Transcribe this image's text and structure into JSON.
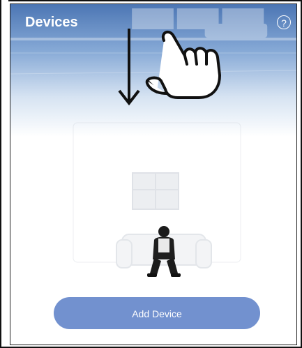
{
  "header": {
    "title": "Devices",
    "help_icon": "question-circle-icon"
  },
  "main": {
    "add_device_label": "Add Device",
    "illustration": "person-on-sofa-empty-state",
    "gesture_hint": "pull-down-hand-gesture"
  },
  "colors": {
    "header_top": "#4f79b6",
    "button": "#7291cf",
    "title_text": "#ffffff"
  }
}
